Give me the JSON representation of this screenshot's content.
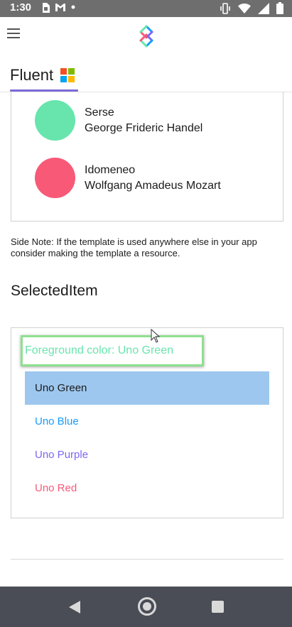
{
  "status_bar": {
    "time": "1:30",
    "icons_left": [
      "sim-card-icon",
      "gmail-icon",
      "dot-icon"
    ],
    "icons_right": [
      "vibrate-icon",
      "wifi-icon",
      "signal-icon",
      "battery-icon"
    ]
  },
  "app_bar": {
    "menu_icon": "hamburger-menu-icon",
    "logo_icon": "uno-platform-logo"
  },
  "tabs": [
    {
      "label": "Fluent",
      "icon": "microsoft-logo-icon",
      "selected": true
    }
  ],
  "list": {
    "items": [
      {
        "title": "Serse",
        "subtitle": "George Frideric Handel",
        "color": "#67e5ad"
      },
      {
        "title": "Idomeneo",
        "subtitle": "Wolfgang Amadeus Mozart",
        "color": "#f85977"
      }
    ]
  },
  "side_note": "Side Note: If the template is used anywhere else in your app consider making the template a resource.",
  "selected_item": {
    "title": "SelectedItem",
    "foreground_label": "Foreground color: Uno Green",
    "foreground_color": "#67e5ad",
    "options": [
      {
        "label": "Uno Green",
        "color": "#1b1b1b",
        "selected": true
      },
      {
        "label": "Uno Blue",
        "color": "#159bff",
        "selected": false
      },
      {
        "label": "Uno Purple",
        "color": "#7a67f8",
        "selected": false
      },
      {
        "label": "Uno Red",
        "color": "#f85977",
        "selected": false
      }
    ]
  },
  "nav_bar": {
    "icons": [
      "back-icon",
      "home-icon",
      "recents-icon"
    ]
  },
  "colors": {
    "status_bar": "#6e6e6e",
    "tab_accent": "#7b6bd8",
    "selected_background": "#9dc7ee",
    "nav_bar": "#4a4d55"
  }
}
